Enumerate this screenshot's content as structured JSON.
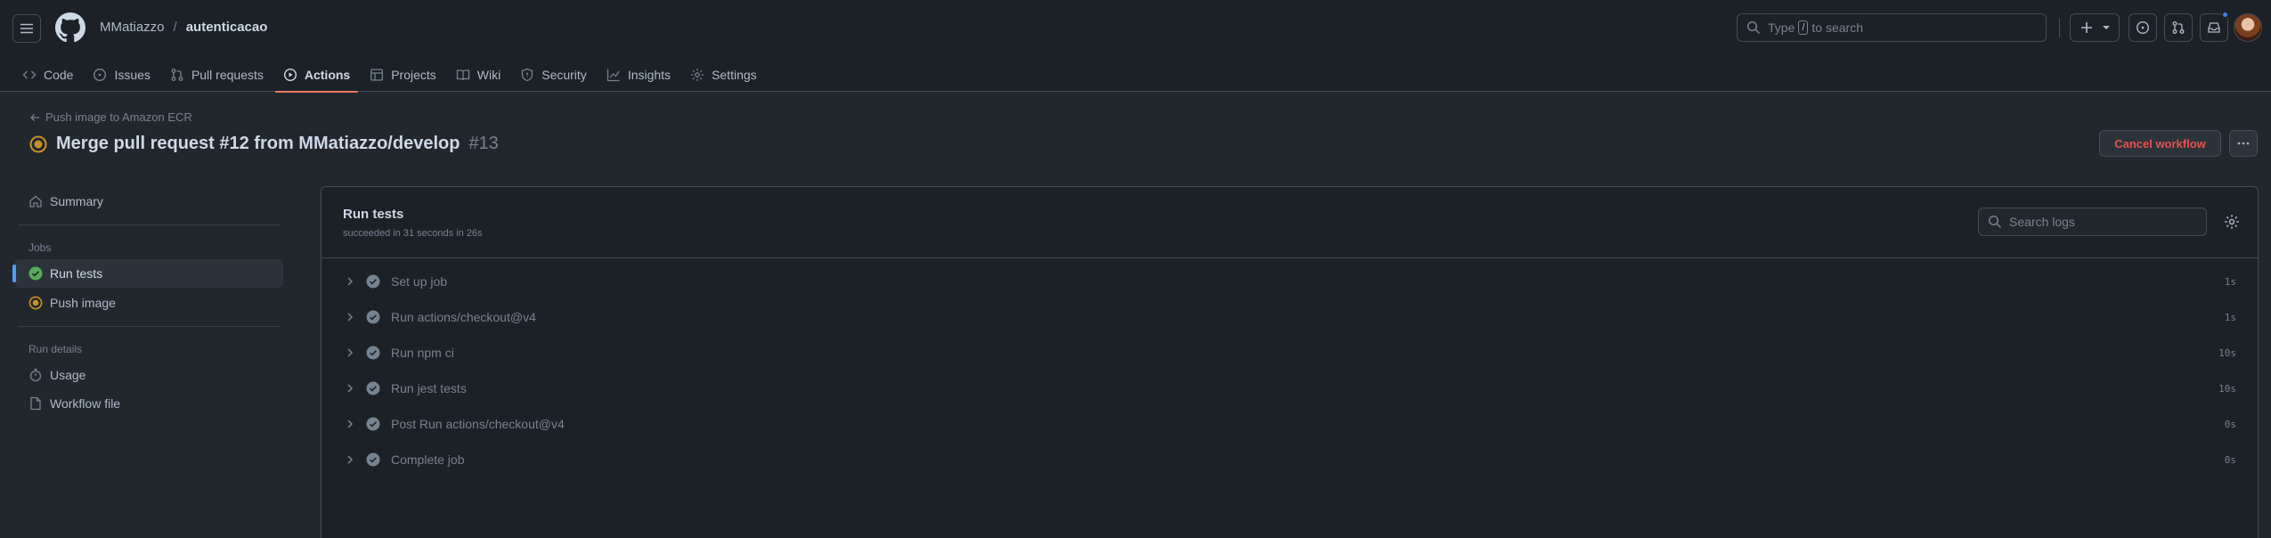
{
  "header": {
    "owner": "MMatiazzo",
    "separator": "/",
    "repo": "autenticacao",
    "search_prefix": "Type",
    "search_key": "/",
    "search_suffix": "to search"
  },
  "tabs": [
    {
      "label": "Code",
      "icon": "code-icon"
    },
    {
      "label": "Issues",
      "icon": "issue-icon"
    },
    {
      "label": "Pull requests",
      "icon": "pull-request-icon"
    },
    {
      "label": "Actions",
      "icon": "play-icon",
      "active": true
    },
    {
      "label": "Projects",
      "icon": "table-icon"
    },
    {
      "label": "Wiki",
      "icon": "book-icon"
    },
    {
      "label": "Security",
      "icon": "shield-icon"
    },
    {
      "label": "Insights",
      "icon": "graph-icon"
    },
    {
      "label": "Settings",
      "icon": "gear-icon"
    }
  ],
  "run": {
    "back_label": "Push image to Amazon ECR",
    "title": "Merge pull request #12 from MMatiazzo/develop",
    "number": "#13",
    "cancel_label": "Cancel workflow"
  },
  "sidebar": {
    "summary": "Summary",
    "jobs_heading": "Jobs",
    "jobs": [
      {
        "label": "Run tests",
        "status": "success"
      },
      {
        "label": "Push image",
        "status": "in-progress"
      }
    ],
    "run_details_heading": "Run details",
    "details": [
      {
        "label": "Usage",
        "icon": "stopwatch-icon"
      },
      {
        "label": "Workflow file",
        "icon": "file-icon"
      }
    ]
  },
  "job": {
    "title": "Run tests",
    "subtitle": "succeeded in 31 seconds in 26s",
    "search_placeholder": "Search logs",
    "steps": [
      {
        "name": "Set up job",
        "duration": "1s"
      },
      {
        "name": "Run actions/checkout@v4",
        "duration": "1s"
      },
      {
        "name": "Run npm ci",
        "duration": "10s"
      },
      {
        "name": "Run jest tests",
        "duration": "10s"
      },
      {
        "name": "Post Run actions/checkout@v4",
        "duration": "0s"
      },
      {
        "name": "Complete job",
        "duration": "0s"
      }
    ]
  },
  "colors": {
    "background": "#22272e",
    "header_background": "#1c2128",
    "accent_underline": "#ec775c",
    "success": "#57ab5a",
    "in_progress": "#c69026",
    "danger": "#e5534b",
    "link": "#539bf5"
  }
}
